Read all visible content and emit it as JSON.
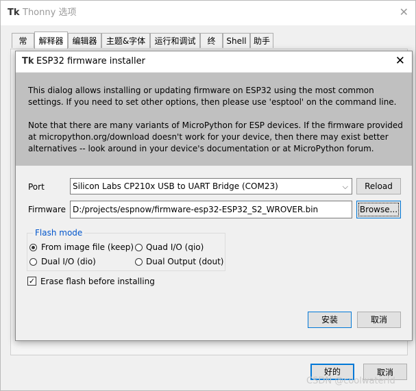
{
  "outer": {
    "title": "Thonny 选项",
    "tabs": [
      "常规",
      "解释器",
      "编辑器",
      "主题&字体",
      "运行和调试",
      "终端",
      "Shell",
      "助手"
    ],
    "active_tab_index": 1,
    "ok_label": "好的",
    "cancel_label": "取消",
    "watermark": "CSDN @coolwaterld"
  },
  "dialog": {
    "title": "ESP32 firmware installer",
    "info_p1": "This dialog allows installing or updating firmware on ESP32 using the most common settings. If you need to set other options, then please use 'esptool' on the command line.",
    "info_p2": "Note that there are many variants of MicroPython for ESP devices. If the firmware provided at micropython.org/download doesn't work for your device, then there may exist better alternatives -- look around in your device's documentation or at MicroPython forum.",
    "port_label": "Port",
    "port_value": "Silicon Labs CP210x USB to UART Bridge (COM23)",
    "reload_label": "Reload",
    "firmware_label": "Firmware",
    "firmware_value": "D:/projects/espnow/firmware-esp32-ESP32_S2_WROVER.bin",
    "browse_label": "Browse...",
    "flash_mode": {
      "legend": "Flash mode",
      "options": [
        "From image file (keep)",
        "Quad I/O (qio)",
        "Dual I/O (dio)",
        "Dual Output (dout)"
      ],
      "selected_index": 0
    },
    "erase_label": "Erase flash before installing",
    "erase_checked": true,
    "install_label": "安装",
    "cancel_label": "取消"
  }
}
